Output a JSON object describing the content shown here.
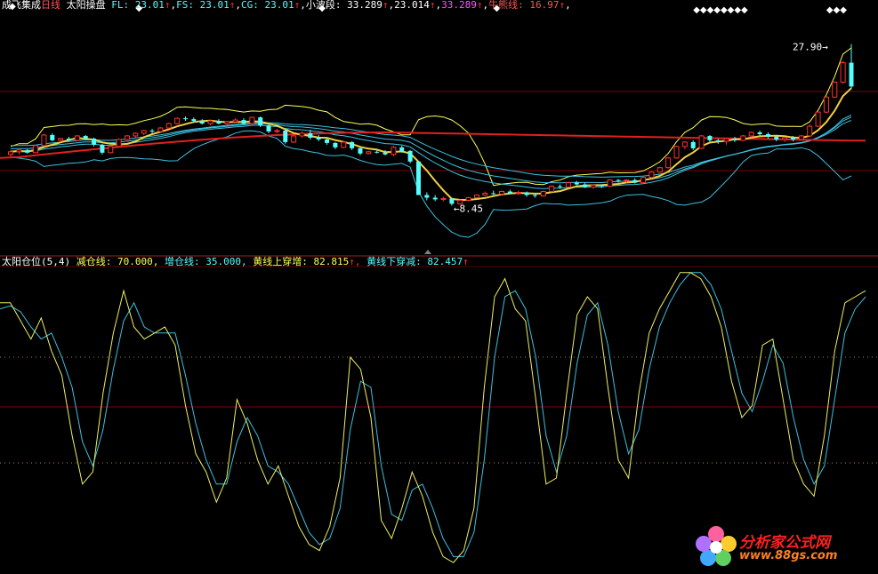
{
  "top_header": {
    "title": "成飞集成",
    "period": "日线",
    "indicator": "太阳操盘",
    "items": [
      {
        "label": "FL:",
        "value": "23.01",
        "arrow": "↑"
      },
      {
        "label": "FS:",
        "value": "23.01",
        "arrow": "↑"
      },
      {
        "label": "CG:",
        "value": "23.01",
        "arrow": "↑"
      },
      {
        "label": "小波段:",
        "value": "33.289",
        "arrow": "↑"
      },
      {
        "label": "",
        "value": "23.014",
        "arrow": "↑"
      },
      {
        "label": "",
        "value": "33.289",
        "arrow": "↑"
      },
      {
        "label": "牛熊线:",
        "value": "16.97",
        "arrow": "↑"
      }
    ]
  },
  "bottom_header": {
    "title": "太阳仓位(5,4)",
    "items": [
      {
        "label": "减仓线:",
        "value": "70.000,"
      },
      {
        "label": "增仓线:",
        "value": "35.000,"
      },
      {
        "label": "黄线上穿增:",
        "value": "82.815",
        "arrow": "↑,"
      },
      {
        "label": "黄线下穿减:",
        "value": "82.457",
        "arrow": "↑"
      }
    ]
  },
  "price_labels": {
    "high": "27.90",
    "low": "8.45"
  },
  "watermark": {
    "name": "分析家公式网",
    "url": "www.88gs.com"
  },
  "colors": {
    "red": "#ff3232",
    "cyan": "#54ffff",
    "yellow": "#ffff54",
    "white": "#ffffff",
    "magenta": "#ff54ff",
    "pink": "#ff5454",
    "grid": "#7f0000",
    "dotted": "#b08040",
    "band": "#3cc0e0",
    "bull_bear": "#e02020",
    "ma": "#f0d040"
  },
  "chart_data": {
    "type": "candlestick",
    "price_range": [
      4.5,
      31.5
    ],
    "candles": [
      [
        15.4,
        15.9,
        15.1,
        15.7
      ],
      [
        15.7,
        16.1,
        15.4,
        15.9
      ],
      [
        15.9,
        16.0,
        15.5,
        15.6
      ],
      [
        15.6,
        16.5,
        15.6,
        16.4
      ],
      [
        16.4,
        17.7,
        16.3,
        17.6
      ],
      [
        17.6,
        17.8,
        16.9,
        17.0
      ],
      [
        17.0,
        17.3,
        16.8,
        17.2
      ],
      [
        17.2,
        17.4,
        16.9,
        17.0
      ],
      [
        17.0,
        17.6,
        16.9,
        17.5
      ],
      [
        17.5,
        17.6,
        17.1,
        17.2
      ],
      [
        17.2,
        17.3,
        16.3,
        16.5
      ],
      [
        16.5,
        16.6,
        15.4,
        15.6
      ],
      [
        15.6,
        16.4,
        15.5,
        16.3
      ],
      [
        16.3,
        17.2,
        16.2,
        17.1
      ],
      [
        17.1,
        17.6,
        16.9,
        17.5
      ],
      [
        17.5,
        17.9,
        17.3,
        17.8
      ],
      [
        17.8,
        18.2,
        17.6,
        18.1
      ],
      [
        18.1,
        18.3,
        17.8,
        18.0
      ],
      [
        18.0,
        18.5,
        17.9,
        18.4
      ],
      [
        18.4,
        19.0,
        18.3,
        18.9
      ],
      [
        18.9,
        19.6,
        18.8,
        19.5
      ],
      [
        19.5,
        19.7,
        19.2,
        19.4
      ],
      [
        19.4,
        19.6,
        19.0,
        19.2
      ],
      [
        19.2,
        19.4,
        18.8,
        18.9
      ],
      [
        18.9,
        19.3,
        18.7,
        19.2
      ],
      [
        19.2,
        19.4,
        18.8,
        18.9
      ],
      [
        18.9,
        19.2,
        18.7,
        19.1
      ],
      [
        19.1,
        19.5,
        19.0,
        19.3
      ],
      [
        19.3,
        19.5,
        18.8,
        18.9
      ],
      [
        18.9,
        19.7,
        18.6,
        19.6
      ],
      [
        19.6,
        19.7,
        18.5,
        18.7
      ],
      [
        18.7,
        18.8,
        17.8,
        18.0
      ],
      [
        18.0,
        18.3,
        17.8,
        18.1
      ],
      [
        18.1,
        18.2,
        16.6,
        16.8
      ],
      [
        16.8,
        17.6,
        16.7,
        17.5
      ],
      [
        17.5,
        18.0,
        17.3,
        17.8
      ],
      [
        17.8,
        18.2,
        17.1,
        17.3
      ],
      [
        17.3,
        17.6,
        16.9,
        17.1
      ],
      [
        17.1,
        17.3,
        16.5,
        16.7
      ],
      [
        16.7,
        16.8,
        16.0,
        16.2
      ],
      [
        16.2,
        16.9,
        16.1,
        16.8
      ],
      [
        16.8,
        16.9,
        15.9,
        16.1
      ],
      [
        16.1,
        16.2,
        15.3,
        15.5
      ],
      [
        15.5,
        15.8,
        15.4,
        15.7
      ],
      [
        15.7,
        16.0,
        15.5,
        15.6
      ],
      [
        15.6,
        15.9,
        15.3,
        15.4
      ],
      [
        15.4,
        16.4,
        15.2,
        16.2
      ],
      [
        16.2,
        16.4,
        15.6,
        15.8
      ],
      [
        15.8,
        15.9,
        14.4,
        14.6
      ],
      [
        14.6,
        11.0,
        11.0,
        10.8
      ],
      [
        10.8,
        11.1,
        10.2,
        10.5
      ],
      [
        10.5,
        10.8,
        10.1,
        10.3
      ],
      [
        10.3,
        10.6,
        10.1,
        10.4
      ],
      [
        10.4,
        10.5,
        9.6,
        9.8
      ],
      [
        9.8,
        10.3,
        9.7,
        10.2
      ],
      [
        10.2,
        10.6,
        10.1,
        10.5
      ],
      [
        10.5,
        10.9,
        10.4,
        10.8
      ],
      [
        10.8,
        11.2,
        10.7,
        11.0
      ],
      [
        11.0,
        11.3,
        10.8,
        10.9
      ],
      [
        10.9,
        11.3,
        10.8,
        11.2
      ],
      [
        11.2,
        11.4,
        10.9,
        11.0
      ],
      [
        11.0,
        11.3,
        10.8,
        11.1
      ],
      [
        11.1,
        11.2,
        10.6,
        10.8
      ],
      [
        10.8,
        11.0,
        10.5,
        10.7
      ],
      [
        10.7,
        11.3,
        10.6,
        11.2
      ],
      [
        11.2,
        11.9,
        11.1,
        11.8
      ],
      [
        11.8,
        12.0,
        11.5,
        11.7
      ],
      [
        11.7,
        12.3,
        11.6,
        12.2
      ],
      [
        12.2,
        12.4,
        11.9,
        12.0
      ],
      [
        12.0,
        12.2,
        11.6,
        11.7
      ],
      [
        11.7,
        12.0,
        11.5,
        11.9
      ],
      [
        11.9,
        12.0,
        11.6,
        11.8
      ],
      [
        11.8,
        12.6,
        11.7,
        12.5
      ],
      [
        12.5,
        12.6,
        12.2,
        12.4
      ],
      [
        12.4,
        12.6,
        12.2,
        12.5
      ],
      [
        12.5,
        12.7,
        12.1,
        12.2
      ],
      [
        12.2,
        12.9,
        12.1,
        12.8
      ],
      [
        12.8,
        13.5,
        12.7,
        13.4
      ],
      [
        13.4,
        14.0,
        13.3,
        13.9
      ],
      [
        13.9,
        15.1,
        13.8,
        15.0
      ],
      [
        15.0,
        16.4,
        14.9,
        16.3
      ],
      [
        16.3,
        16.9,
        16.0,
        16.8
      ],
      [
        16.8,
        17.0,
        15.9,
        16.1
      ],
      [
        16.1,
        17.6,
        16.0,
        17.5
      ],
      [
        17.5,
        17.6,
        16.8,
        17.0
      ],
      [
        17.0,
        17.2,
        16.6,
        16.9
      ],
      [
        16.9,
        17.3,
        16.5,
        17.2
      ],
      [
        17.2,
        17.4,
        16.8,
        17.0
      ],
      [
        17.0,
        17.6,
        16.9,
        17.5
      ],
      [
        17.5,
        18.0,
        17.3,
        17.9
      ],
      [
        17.9,
        18.1,
        17.5,
        17.7
      ],
      [
        17.7,
        17.9,
        17.2,
        17.4
      ],
      [
        17.4,
        17.6,
        16.9,
        17.1
      ],
      [
        17.1,
        17.4,
        16.8,
        17.3
      ],
      [
        17.3,
        17.5,
        16.9,
        17.1
      ],
      [
        17.1,
        17.6,
        17.0,
        17.5
      ],
      [
        17.5,
        18.8,
        17.4,
        18.6
      ],
      [
        18.6,
        20.3,
        18.5,
        20.2
      ],
      [
        20.2,
        22.0,
        20.1,
        21.9
      ],
      [
        21.9,
        23.7,
        21.8,
        23.6
      ],
      [
        23.6,
        26.0,
        23.4,
        25.8
      ],
      [
        25.8,
        27.9,
        22.8,
        23.1
      ]
    ],
    "bull_bear_line": {
      "start": 15.0,
      "peak": 17.9,
      "end": 16.97
    },
    "osc_range": [
      0,
      100
    ],
    "osc_levels": [
      70,
      35
    ],
    "osc_labels": {
      "reduce": "减仓线",
      "add": "增仓线"
    },
    "yellow_osc": [
      88,
      88,
      82,
      76,
      83,
      72,
      64,
      44,
      28,
      32,
      58,
      78,
      92,
      80,
      76,
      78,
      80,
      74,
      54,
      38,
      32,
      22,
      30,
      56,
      48,
      36,
      28,
      34,
      24,
      14,
      8,
      6,
      14,
      30,
      70,
      66,
      50,
      16,
      10,
      20,
      32,
      24,
      12,
      4,
      2,
      6,
      20,
      60,
      90,
      96,
      86,
      82,
      56,
      28,
      30,
      58,
      84,
      90,
      86,
      60,
      36,
      30,
      58,
      78,
      86,
      92,
      98,
      98,
      96,
      90,
      80,
      62,
      50,
      54,
      74,
      76,
      56,
      36,
      28,
      24,
      44,
      72,
      88,
      90,
      92
    ],
    "cyan_osc": [
      86,
      87,
      85,
      80,
      76,
      78,
      70,
      60,
      42,
      34,
      46,
      66,
      82,
      88,
      80,
      78,
      78,
      78,
      64,
      48,
      36,
      28,
      28,
      42,
      50,
      44,
      34,
      32,
      28,
      20,
      12,
      8,
      10,
      20,
      46,
      62,
      60,
      34,
      18,
      16,
      26,
      28,
      20,
      10,
      4,
      4,
      12,
      36,
      70,
      90,
      92,
      86,
      70,
      44,
      32,
      44,
      68,
      84,
      88,
      74,
      52,
      38,
      46,
      66,
      80,
      88,
      94,
      98,
      98,
      94,
      86,
      72,
      58,
      52,
      62,
      74,
      68,
      50,
      36,
      28,
      34,
      56,
      78,
      86,
      90
    ]
  }
}
